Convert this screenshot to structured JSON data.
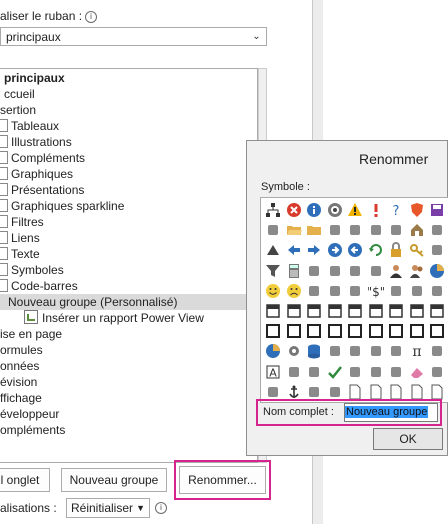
{
  "options": {
    "customize_label": "aliser le ruban :",
    "ribbon_select_value": "principaux",
    "tree": [
      {
        "label": "principaux",
        "indent": 4,
        "bold": true
      },
      {
        "label": "ccueil",
        "indent": 4
      },
      {
        "label": "sertion",
        "indent": 0
      },
      {
        "label": "Tableaux",
        "indent": 0,
        "cb": true
      },
      {
        "label": "Illustrations",
        "indent": 0,
        "cb": true
      },
      {
        "label": "Compléments",
        "indent": 0,
        "cb": true
      },
      {
        "label": "Graphiques",
        "indent": 0,
        "cb": true
      },
      {
        "label": "Présentations",
        "indent": 0,
        "cb": true
      },
      {
        "label": "Graphiques sparkline",
        "indent": 0,
        "cb": true
      },
      {
        "label": "Filtres",
        "indent": 0,
        "cb": true
      },
      {
        "label": "Liens",
        "indent": 0,
        "cb": true
      },
      {
        "label": "Texte",
        "indent": 0,
        "cb": true
      },
      {
        "label": "Symboles",
        "indent": 0,
        "cb": true
      },
      {
        "label": "Code-barres",
        "indent": 0,
        "cb": true
      },
      {
        "label": "Nouveau groupe (Personnalisé)",
        "indent": 8,
        "selected": true
      },
      {
        "label": "Insérer un rapport Power View",
        "indent": 24,
        "icon": true
      },
      {
        "label": "ise en page",
        "indent": 0
      },
      {
        "label": "ormules",
        "indent": 0
      },
      {
        "label": "onnées",
        "indent": 0
      },
      {
        "label": "évision",
        "indent": 0
      },
      {
        "label": "ffichage",
        "indent": 0
      },
      {
        "label": "éveloppeur",
        "indent": 0
      },
      {
        "label": "ompléments",
        "indent": 0
      }
    ],
    "new_tab_label": "l onglet",
    "new_group_label": "Nouveau groupe",
    "rename_label": "Renommer...",
    "customizations_label": "alisations :",
    "reset_label": "Réinitialiser"
  },
  "dialog": {
    "title": "Renommer",
    "symbol_label": "Symbole :",
    "name_label": "Nom complet :",
    "name_value": "Nouveau groupe",
    "ok_label": "OK",
    "symbols": [
      [
        "sitemap-icon",
        "error-x-icon",
        "info-icon",
        "record-icon",
        "warning-icon",
        "exclamation-icon",
        "question-icon",
        "shield-icon",
        "save-icon"
      ],
      [
        "help-doc-icon",
        "folder-open-icon",
        "folder-icon",
        "folder-down-icon",
        "pin-icon",
        "star-folder-icon",
        "export-icon",
        "home-icon",
        "palette-icon"
      ],
      [
        "triangle-up-icon",
        "arrow-left-icon",
        "arrow-right-icon",
        "arrow-circle-right-icon",
        "arrow-circle-left-icon",
        "refresh-icon",
        "lock-icon",
        "key-icon",
        "puzzle-icon"
      ],
      [
        "filter-icon",
        "calculator-icon",
        "scales-icon",
        "vcr-icon",
        "microphone-icon",
        "mute-icon",
        "user-icon",
        "users-icon",
        "pie-icon"
      ],
      [
        "smile-icon",
        "sad-icon",
        "phone-icon",
        "vcard-icon",
        "mouth-icon",
        "dollar-icon",
        "eye-icon",
        "chain-icon",
        "layers-icon"
      ],
      [
        "table-icon",
        "table-icon",
        "table-icon",
        "table-icon",
        "table-icon",
        "table-icon",
        "table-icon",
        "table-icon",
        "table-icon"
      ],
      [
        "frame-icon",
        "frame-icon",
        "frame-icon",
        "frame-icon",
        "frame-icon",
        "frame-icon",
        "frame-icon",
        "frame-icon",
        "frame-icon"
      ],
      [
        "pie-icon",
        "gear-icon",
        "database-icon",
        "book-icon",
        "chart-icon",
        "grid-icon",
        "graph-icon",
        "pi-icon",
        "funnel-icon"
      ],
      [
        "text-box-icon",
        "check-a-icon",
        "check-b-icon",
        "check-icon",
        "doc-add-icon",
        "note-icon",
        "edit-icon",
        "eraser-icon",
        "highlight-icon"
      ],
      [
        "sort-icon",
        "anchor-icon",
        "bag-icon",
        "flow-icon",
        "doc-icon",
        "doc-icon",
        "doc-icon",
        "doc-icon",
        "doc-icon"
      ]
    ]
  },
  "colors": {
    "highlight_border": "#d6248f",
    "selection": "#3399ff"
  }
}
